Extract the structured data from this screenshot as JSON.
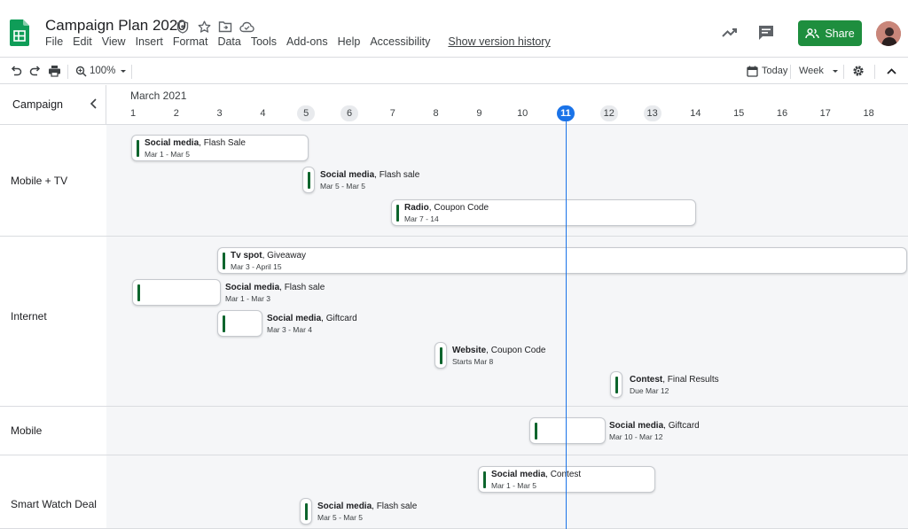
{
  "header": {
    "title": "Campaign Plan 2020",
    "menu": [
      "File",
      "Edit",
      "View",
      "Insert",
      "Format",
      "Data",
      "Tools",
      "Add-ons",
      "Help",
      "Accessibility"
    ],
    "version_history": "Show version history",
    "share_label": "Share",
    "brand_color": "#1e8e3e"
  },
  "toolbar": {
    "zoom": "100%",
    "today_label": "Today",
    "view_label": "Week"
  },
  "timeline": {
    "group_column_label": "Campaign",
    "month": "March 2021",
    "days": [
      "1",
      "2",
      "3",
      "4",
      "5",
      "6",
      "7",
      "8",
      "9",
      "10",
      "11",
      "12",
      "13",
      "14",
      "15",
      "16",
      "17",
      "18"
    ],
    "weekend_days": [
      "5",
      "6",
      "12",
      "13"
    ],
    "today": "11",
    "accent_color": "#1a73e8",
    "groups": [
      {
        "label": "Mobile + TV",
        "cards": [
          {
            "type": "Social media",
            "name": "Flash Sale",
            "dates": "Mar 1 - Mar 5"
          },
          {
            "type": "Social media",
            "name": "Flash sale",
            "dates": "Mar 5 - Mar 5"
          },
          {
            "type": "Radio",
            "name": "Coupon Code",
            "dates": "Mar 7 - 14"
          }
        ]
      },
      {
        "label": "Internet",
        "cards": [
          {
            "type": "Tv spot",
            "name": "Giveaway",
            "dates": "Mar 3 - April 15"
          },
          {
            "type": "Social media",
            "name": "Flash sale",
            "dates": "Mar 1 - Mar 3"
          },
          {
            "type": "Social media",
            "name": "Giftcard",
            "dates": "Mar 3 - Mar 4"
          },
          {
            "type": "Website",
            "name": "Coupon Code",
            "dates": "Starts Mar 8"
          },
          {
            "type": "Contest",
            "name": "Final Results",
            "dates": "Due Mar 12"
          }
        ]
      },
      {
        "label": "Mobile",
        "cards": [
          {
            "type": "Social media",
            "name": "Giftcard",
            "dates": "Mar 10 - Mar 12"
          }
        ]
      },
      {
        "label": "Smart Watch Deal",
        "cards": [
          {
            "type": "Social media",
            "name": "Contest",
            "dates": "Mar 1 - Mar 5"
          },
          {
            "type": "Social media",
            "name": "Flash sale",
            "dates": "Mar 5 - Mar 5"
          }
        ]
      }
    ]
  }
}
